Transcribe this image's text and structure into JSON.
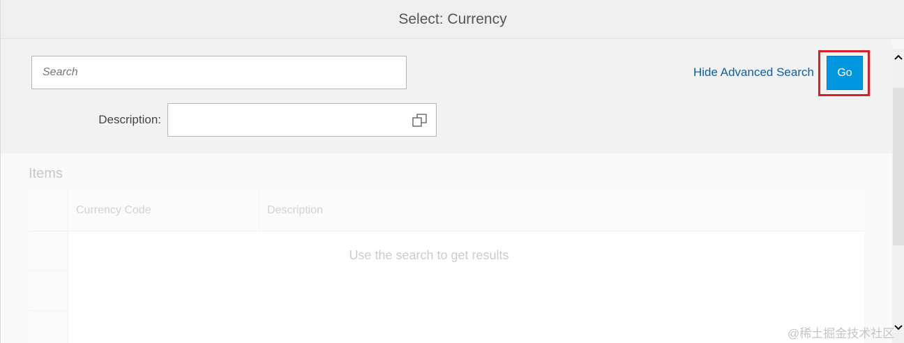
{
  "dialog": {
    "title": "Select: Currency"
  },
  "filter_bar": {
    "search_placeholder": "Search",
    "search_value": "",
    "hide_advanced_search": "Hide Advanced Search",
    "go": "Go"
  },
  "fields": {
    "description_label": "Description:",
    "description_value": ""
  },
  "table": {
    "title": "Items",
    "columns": [
      "Currency Code",
      "Description"
    ],
    "no_data_text": "Use the search to get results"
  },
  "watermark": "@稀土掘金技术社区",
  "colors": {
    "accent": "#0096e0",
    "link": "#0a5fa4",
    "highlight": "#d71f26"
  },
  "icons": {
    "value_help": "value-help-icon",
    "scroll_up": "chevron-up-icon",
    "scroll_down": "chevron-down-icon"
  }
}
